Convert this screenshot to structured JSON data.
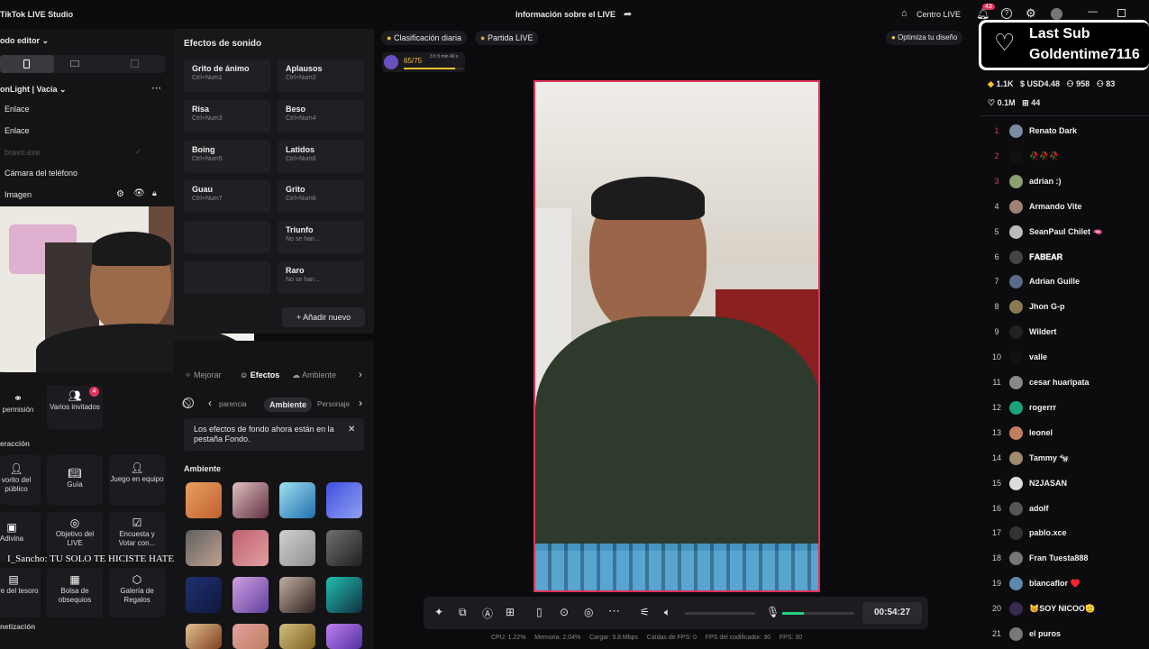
{
  "app": {
    "title": "TikTok LIVE Studio",
    "center_title": "Información sobre el LIVE",
    "live_center": "Centro LIVE",
    "notif_count": "43"
  },
  "left": {
    "mode": "odo editor",
    "scene": "onLight | Vacía",
    "items": [
      "Enlace",
      "Enlace",
      "bravo.exe",
      "Cámara del teléfono",
      "Imagen"
    ],
    "overlay_chat": "I_Sancho: TU SOLO TE HICISTE HATE",
    "section_interaction": "eracción",
    "section_monetization": "netización",
    "tools": [
      {
        "label": "permisión",
        "icon": "link-icon"
      },
      {
        "label": "Varios invitados",
        "icon": "guests-icon",
        "badge": "4"
      },
      {
        "label": "vorito del público",
        "icon": "audience-icon"
      },
      {
        "label": "Guía",
        "icon": "guide-icon"
      },
      {
        "label": "Juego en equipo",
        "icon": "team-game-icon"
      },
      {
        "label": "Adivina",
        "icon": "guess-icon"
      },
      {
        "label": "Objetivo del LIVE",
        "icon": "goal-icon"
      },
      {
        "label": "Encuesta y Votar con...",
        "icon": "poll-icon"
      },
      {
        "label": "cofre del tesoro",
        "icon": "chest-icon"
      },
      {
        "label": "Bolsa de obsequios",
        "icon": "gift-bag-icon"
      },
      {
        "label": "Galería de Regalos",
        "icon": "gift-gallery-icon"
      }
    ]
  },
  "sound": {
    "title": "Efectos de sonido",
    "buttons": [
      {
        "name": "Grito de ánimo",
        "key": "Ctrl+Num1"
      },
      {
        "name": "Aplausos",
        "key": "Ctrl+Num2"
      },
      {
        "name": "Risa",
        "key": "Ctrl+Num3"
      },
      {
        "name": "Beso",
        "key": "Ctrl+Num4"
      },
      {
        "name": "Boing",
        "key": "Ctrl+Num5"
      },
      {
        "name": "Latidos",
        "key": "Ctrl+Num6"
      },
      {
        "name": "Guau",
        "key": "Ctrl+Num7"
      },
      {
        "name": "Grito",
        "key": "Ctrl+Num8"
      },
      {
        "name": "Triunfo",
        "key": "No se han..."
      },
      {
        "name": "Raro",
        "key": "No se han..."
      }
    ],
    "add": "Añadir nuevo"
  },
  "effects": {
    "tabs": [
      "Mejorar",
      "Efectos",
      "Ambiente"
    ],
    "subtabs": [
      "parencia",
      "Ambiente",
      "Personaje"
    ],
    "notice": "Los efectos de fondo ahora están en la pestaña Fondo.",
    "section": "Ambiente"
  },
  "center": {
    "daily_rank": "Clasificación diaria",
    "live_match": "Partida LIVE",
    "optimize": "Optimiza tu diseño",
    "level": "65/75",
    "level_time": "3 h 5 min 40 s",
    "level_progress": 0.87,
    "timer": "00:54:27",
    "stats": [
      "CPU: 1.22%",
      "Memoria: 2.04%",
      "Cargar: 3.8 Mbps",
      "Caídas de FPS: 0",
      "FPS del codificador: 30",
      "FPS: 30"
    ]
  },
  "right": {
    "last_sub_title": "Last Sub",
    "last_sub_name": "Goldentime7116",
    "stats": {
      "coins": "1.1K",
      "usd": "USD4.48",
      "viewers": "958",
      "likes": "0.1M",
      "gifts": "44",
      "extra": "83"
    },
    "leaderboard": [
      {
        "rank": "1",
        "name": "Renato Dark",
        "color": "#7a8aa0"
      },
      {
        "rank": "2",
        "name": "🥀🥀🥀",
        "color": "#111"
      },
      {
        "rank": "3",
        "name": "adrian :)",
        "color": "#8aa070"
      },
      {
        "rank": "4",
        "name": "Armando Vite",
        "color": "#a08070"
      },
      {
        "rank": "5",
        "name": "SeanPaul Chilet 🫦",
        "color": "#bbb"
      },
      {
        "rank": "6",
        "name": "𝐅𝐀𝐁𝐄𝐀𝐑",
        "color": "#444"
      },
      {
        "rank": "7",
        "name": "Adrian Guille",
        "color": "#5a6a8a"
      },
      {
        "rank": "8",
        "name": "Jhon G-p",
        "color": "#8a7a50"
      },
      {
        "rank": "9",
        "name": "Wildert",
        "color": "#222"
      },
      {
        "rank": "10",
        "name": "valle",
        "color": "#111"
      },
      {
        "rank": "11",
        "name": "cesar huaripata",
        "color": "#888"
      },
      {
        "rank": "12",
        "name": "rogerrr",
        "color": "#1aa37a"
      },
      {
        "rank": "13",
        "name": "leonel",
        "color": "#c08060"
      },
      {
        "rank": "14",
        "name": "Tammy 🐄",
        "color": "#a08a70"
      },
      {
        "rank": "15",
        "name": "N2JASAN",
        "color": "#ddd"
      },
      {
        "rank": "16",
        "name": "adolf",
        "color": "#555"
      },
      {
        "rank": "17",
        "name": "pablo.xce",
        "color": "#333"
      },
      {
        "rank": "18",
        "name": "Fran Tuesta888",
        "color": "#777"
      },
      {
        "rank": "19",
        "name": "blancaflor ♥️",
        "color": "#5a8ab0"
      },
      {
        "rank": "20",
        "name": "😽SOY NICOO🫡",
        "color": "#3a2a50"
      },
      {
        "rank": "21",
        "name": "el puros",
        "color": "#777"
      }
    ]
  }
}
